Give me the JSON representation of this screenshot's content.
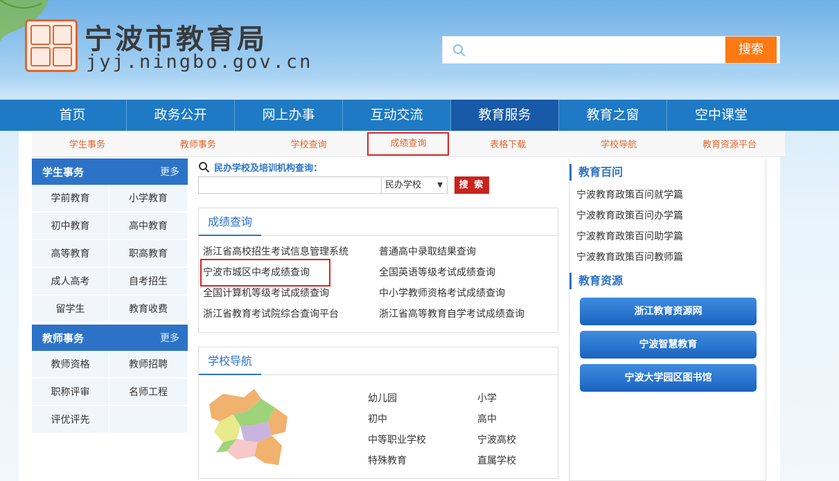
{
  "header": {
    "title": "宁波市教育局",
    "domain": "jyj.ningbo.gov.cn",
    "search_placeholder": "",
    "search_button": "搜索"
  },
  "nav": {
    "items": [
      "首页",
      "政务公开",
      "网上办事",
      "互动交流",
      "教育服务",
      "教育之窗",
      "空中课堂"
    ],
    "active": "教育服务"
  },
  "subnav": {
    "items": [
      "学生事务",
      "教师事务",
      "学校查询",
      "成绩查询",
      "表格下载",
      "学校导航",
      "教育资源平台"
    ]
  },
  "sidebar": {
    "student": {
      "title": "学生事务",
      "more": "更多",
      "items": [
        "学前教育",
        "小学教育",
        "初中教育",
        "高中教育",
        "高等教育",
        "职高教育",
        "成人高考",
        "自考招生",
        "留学生",
        "教育收费"
      ]
    },
    "teacher": {
      "title": "教师事务",
      "more": "更多",
      "items": [
        "教师资格",
        "教师招聘",
        "职称评审",
        "名师工程",
        "评优评先",
        ""
      ]
    }
  },
  "org_query": {
    "label": "民办学校及培训机构查询：",
    "input_value": "",
    "select_value": "民办学校",
    "button": "搜 索"
  },
  "score_query": {
    "title": "成绩查询",
    "links": [
      "浙江省高校招生考试信息管理系统",
      "普通高中录取结果查询",
      "宁波市城区中考成绩查询",
      "全国英语等级考试成绩查询",
      "全国计算机等级考试成绩查询",
      "中小学教师资格考试成绩查询",
      "浙江省教育考试院综合查询平台",
      "浙江省高等教育自学考试成绩查询"
    ]
  },
  "school_nav": {
    "title": "学校导航",
    "links": [
      "幼儿园",
      "小学",
      "初中",
      "高中",
      "中等职业学校",
      "宁波高校",
      "特殊教育",
      "直属学校"
    ]
  },
  "right": {
    "faq_title": "教育百问",
    "faq": [
      "宁波教育政策百问就学篇",
      "宁波教育政策百问办学篇",
      "宁波教育政策百问助学篇",
      "宁波教育政策百问教师篇"
    ],
    "resources_title": "教育资源",
    "resources": [
      "浙江教育资源网",
      "宁波智慧教育",
      "宁波大学园区图书馆"
    ]
  },
  "colors": {
    "nav_bg": "#1e7ac4",
    "nav_active": "#1859a8",
    "accent_orange": "#ff7a15",
    "subnav_text": "#e2662e",
    "highlight_red": "#d92424",
    "link_blue": "#2c73c7"
  }
}
